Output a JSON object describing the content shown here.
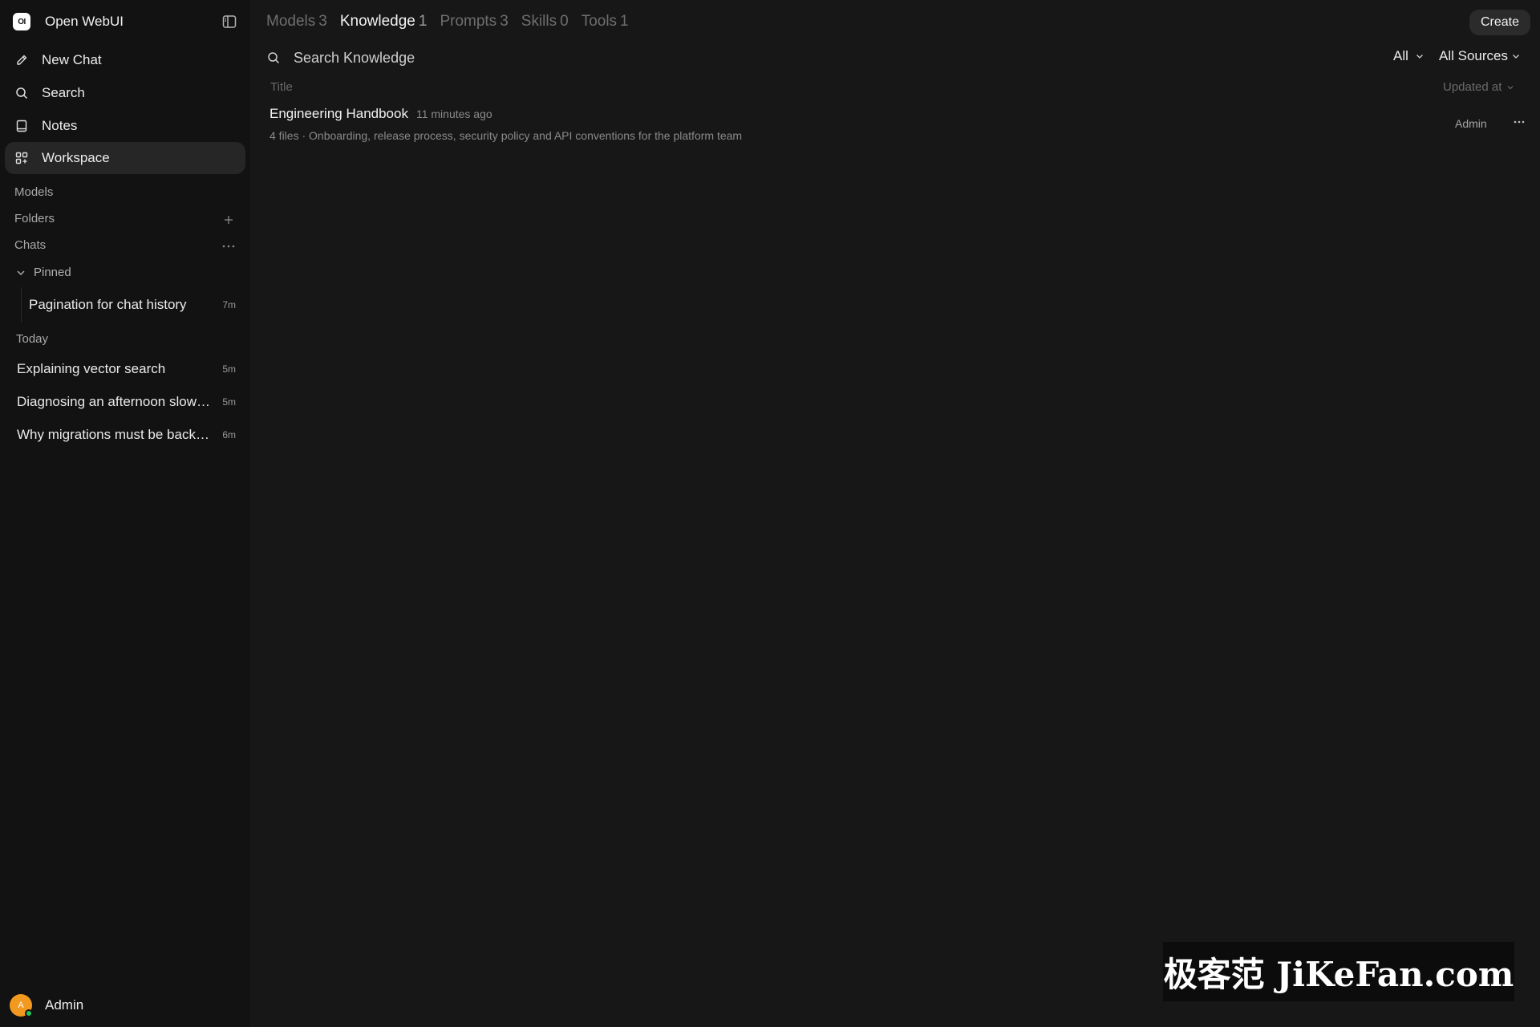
{
  "app": {
    "brand_logo_text": "OI",
    "name": "Open WebUI"
  },
  "sidebar": {
    "nav": [
      {
        "label": "New Chat",
        "icon": "pencil-icon"
      },
      {
        "label": "Search",
        "icon": "search-icon"
      },
      {
        "label": "Notes",
        "icon": "notes-icon"
      },
      {
        "label": "Workspace",
        "icon": "grid-icon",
        "active": true
      }
    ],
    "sections": {
      "models": "Models",
      "folders": "Folders",
      "chats": "Chats"
    },
    "pinned": {
      "label": "Pinned",
      "items": [
        {
          "title": "Pagination for chat history",
          "time": "7m"
        }
      ]
    },
    "today": {
      "label": "Today",
      "items": [
        {
          "title": "Explaining vector search",
          "time": "5m"
        },
        {
          "title": "Diagnosing an afternoon slowdown",
          "time": "5m"
        },
        {
          "title": "Why migrations must be backward compatible",
          "time": "6m"
        }
      ]
    },
    "user": {
      "initial": "A",
      "name": "Admin"
    }
  },
  "workspace": {
    "tabs": [
      {
        "label": "Models",
        "count": "3"
      },
      {
        "label": "Knowledge",
        "count": "1",
        "active": true
      },
      {
        "label": "Prompts",
        "count": "3"
      },
      {
        "label": "Skills",
        "count": "0"
      },
      {
        "label": "Tools",
        "count": "1"
      }
    ],
    "create_label": "Create",
    "search": {
      "placeholder": "Search Knowledge",
      "value": ""
    },
    "filters": {
      "type": "All",
      "source": "All Sources"
    },
    "columns": {
      "title": "Title",
      "sort": "Updated at"
    },
    "items": [
      {
        "name": "Engineering Handbook",
        "updated": "11 minutes ago",
        "description": "4 files · Onboarding, release process, security policy and API conventions for the platform team",
        "owner": "Admin"
      }
    ]
  },
  "watermark": "极客范 JiKeFan.com",
  "colors": {
    "background": "#171717",
    "sidebar": "#121212",
    "active_item": "#262626",
    "avatar": "#f29a1f",
    "online": "#22c55e"
  }
}
